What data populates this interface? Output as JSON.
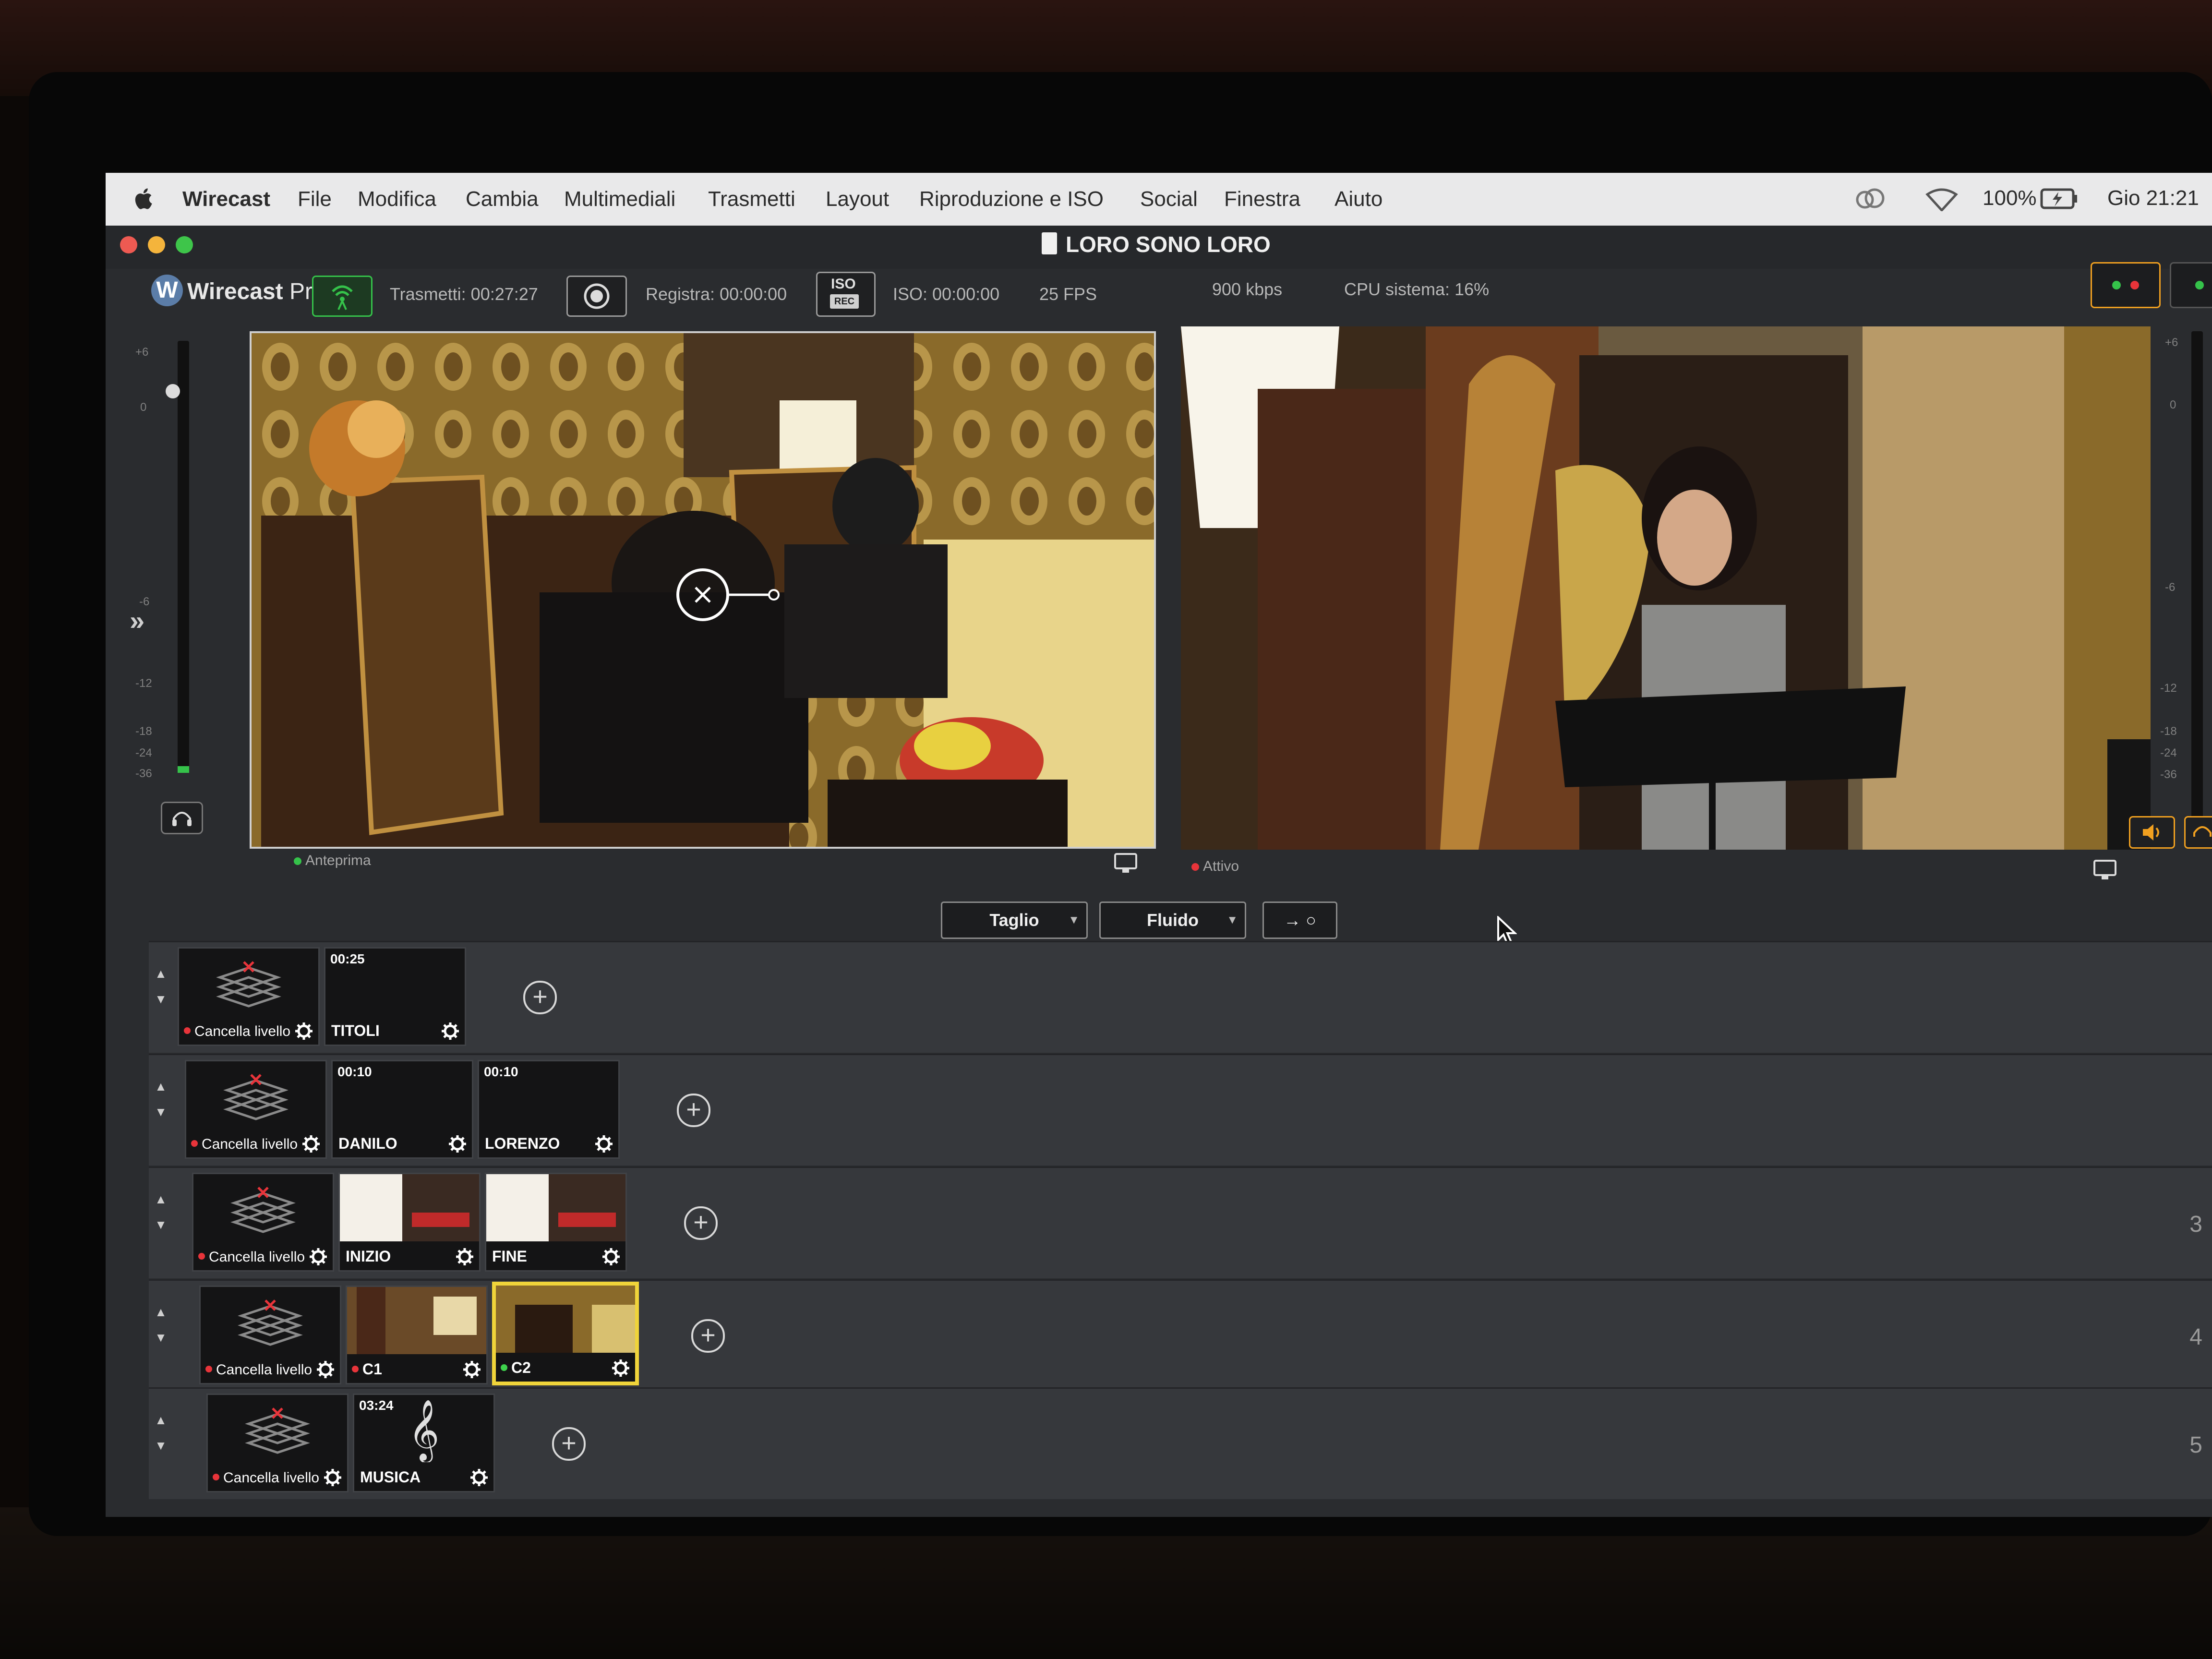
{
  "menubar": {
    "app_name": "Wirecast",
    "menus": [
      "File",
      "Modifica",
      "Cambia",
      "Multimediali",
      "Trasmetti",
      "Layout",
      "Riproduzione e ISO",
      "Social",
      "Finestra",
      "Aiuto"
    ],
    "battery": "100%",
    "clock": "Gio 21:21"
  },
  "window": {
    "title": "LORO SONO LORO"
  },
  "toolbar": {
    "logo_brand": "Wirecast",
    "logo_edition": "Pro",
    "stream_time": "Trasmetti: 00:27:27",
    "record_time": "Registra: 00:00:00",
    "iso_badge_top": "ISO",
    "iso_badge_bottom": "REC",
    "iso_time": "ISO: 00:00:00",
    "fps": "25 FPS",
    "bitrate": "900 kbps",
    "cpu": "CPU sistema: 16%"
  },
  "meters": {
    "left_ticks": [
      "+6",
      "0",
      "-6",
      "-12",
      "-18",
      "-24",
      "-36"
    ],
    "right_ticks": [
      "+6",
      "0",
      "-6",
      "-12",
      "-18",
      "-24",
      "-36"
    ]
  },
  "preview": {
    "label": "Anteprima"
  },
  "live": {
    "label": "Attivo"
  },
  "transitions": {
    "cut": "Taglio",
    "smooth": "Fluido",
    "go_symbol": "→ ○"
  },
  "layers": [
    {
      "number": "",
      "clear_label": "Cancella livello",
      "shots": [
        {
          "name": "TITOLI",
          "time": "00:25"
        }
      ]
    },
    {
      "number": "",
      "clear_label": "Cancella livello",
      "shots": [
        {
          "name": "DANILO",
          "time": "00:10"
        },
        {
          "name": "LORENZO",
          "time": "00:10"
        }
      ]
    },
    {
      "number": "3",
      "clear_label": "Cancella livello",
      "shots": [
        {
          "name": "INIZIO",
          "time": ""
        },
        {
          "name": "FINE",
          "time": ""
        }
      ]
    },
    {
      "number": "4",
      "clear_label": "Cancella livello",
      "shots": [
        {
          "name": "C1",
          "time": ""
        },
        {
          "name": "C2",
          "time": ""
        }
      ]
    },
    {
      "number": "5",
      "clear_label": "Cancella livello",
      "shots": [
        {
          "name": "MUSICA",
          "time": "03:24"
        }
      ]
    }
  ],
  "colors": {
    "accent_green": "#35c24a",
    "accent_orange": "#f0a020",
    "selected_yellow": "#f0d43a",
    "live_red": "#e8343a"
  }
}
